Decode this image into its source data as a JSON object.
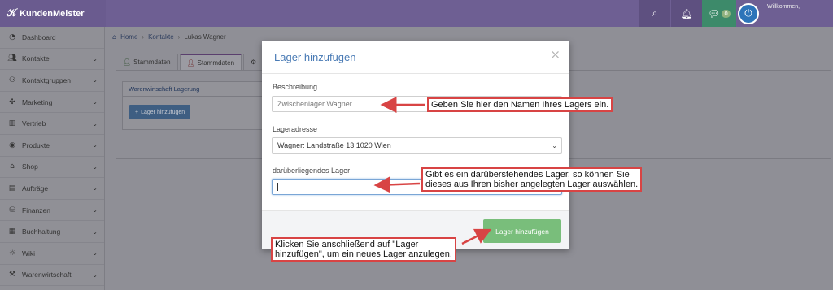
{
  "app": {
    "brand": "KundenMeister",
    "welcome": "Willkommen,"
  },
  "topbar": {
    "chat_count": "0"
  },
  "sidebar": {
    "items": [
      {
        "label": "Dashboard",
        "icon": "dashboard-icon",
        "chevron": false
      },
      {
        "label": "Kontakte",
        "icon": "contacts-icon",
        "chevron": true
      },
      {
        "label": "Kontaktgruppen",
        "icon": "groups-icon",
        "chevron": true
      },
      {
        "label": "Marketing",
        "icon": "marketing-icon",
        "chevron": true
      },
      {
        "label": "Vertrieb",
        "icon": "chart-icon",
        "chevron": true
      },
      {
        "label": "Produkte",
        "icon": "box-icon",
        "chevron": true
      },
      {
        "label": "Shop",
        "icon": "tag-icon",
        "chevron": true
      },
      {
        "label": "Aufträge",
        "icon": "clipboard-icon",
        "chevron": true
      },
      {
        "label": "Finanzen",
        "icon": "money-icon",
        "chevron": true
      },
      {
        "label": "Buchhaltung",
        "icon": "calculator-icon",
        "chevron": true
      },
      {
        "label": "Wiki",
        "icon": "bulb-icon",
        "chevron": true
      },
      {
        "label": "Warenwirtschaft",
        "icon": "warehouse-icon",
        "chevron": true
      }
    ]
  },
  "breadcrumb": {
    "home": "Home",
    "contacts": "Kontakte",
    "current": "Lukas Wagner"
  },
  "tabs": [
    {
      "label": "Stammdaten"
    },
    {
      "label": "Stammdaten"
    }
  ],
  "panel": {
    "title": "Warenwirtschaft Lagerung",
    "button": "Lager hinzufügen"
  },
  "modal": {
    "title": "Lager hinzufügen",
    "close": "×",
    "beschreibung_label": "Beschreibung",
    "beschreibung_value": "Zwischenlager Wagner",
    "lageradresse_label": "Lageradresse",
    "lageradresse_value": "Wagner: Landstraße 13 1020 Wien",
    "parent_label": "darüberliegendes Lager",
    "parent_value": "",
    "submit": "Lager hinzufügen"
  },
  "annotations": {
    "name_hint": "Geben Sie hier den Namen Ihres Lagers ein.",
    "parent_hint_1": "Gibt es ein darüberstehendes Lager, so können Sie",
    "parent_hint_2": "dieses aus Ihren bisher angelegten Lager auswählen.",
    "submit_hint_1": "Klicken Sie anschließend auf \"Lager",
    "submit_hint_2": "hinzufügen\", um ein neues Lager anzulegen."
  },
  "colors": {
    "topbar": "#6e5f93",
    "modal_title": "#4a7bb5",
    "submit": "#79be7b",
    "annotation_border": "#d84444"
  }
}
